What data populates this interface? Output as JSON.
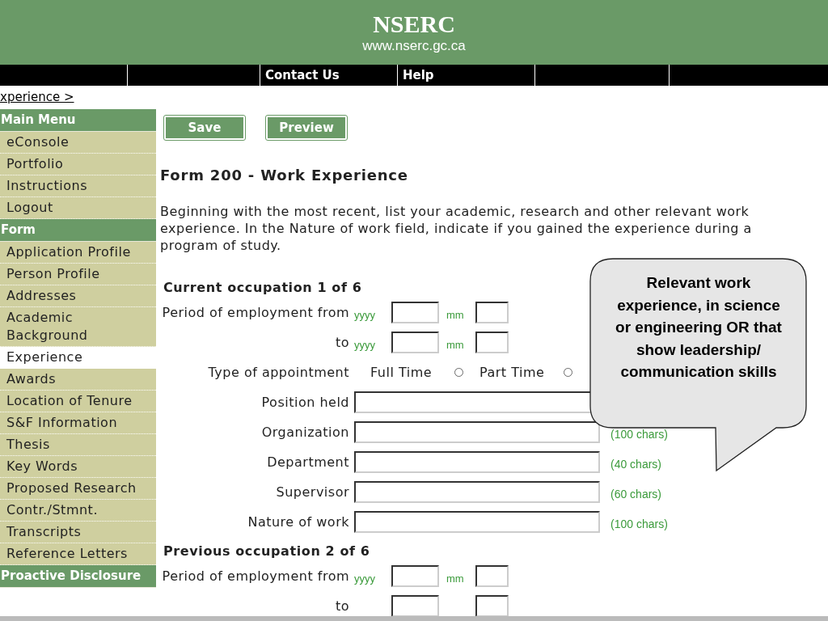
{
  "header": {
    "title": "NSERC",
    "url": "www.nserc.gc.ca"
  },
  "nav": [
    {
      "label": "Contact Us"
    },
    {
      "label": "Help"
    }
  ],
  "breadcrumb": "xperience >",
  "sidebar": [
    {
      "title": "Main Menu",
      "items": [
        {
          "label": "eConsole",
          "selected": false
        },
        {
          "label": "Portfolio",
          "selected": false
        },
        {
          "label": "Instructions",
          "selected": false
        },
        {
          "label": "Logout",
          "selected": false
        }
      ]
    },
    {
      "title": "Form",
      "items": [
        {
          "label": "Application Profile",
          "selected": false
        },
        {
          "label": "Person Profile",
          "selected": false
        },
        {
          "label": "Addresses",
          "selected": false
        },
        {
          "label": "Academic Background",
          "selected": false
        },
        {
          "label": "Experience",
          "selected": true
        },
        {
          "label": "Awards",
          "selected": false
        },
        {
          "label": "Location of Tenure",
          "selected": false
        },
        {
          "label": "S&F Information",
          "selected": false
        },
        {
          "label": "Thesis",
          "selected": false
        },
        {
          "label": "Key Words",
          "selected": false
        },
        {
          "label": "Proposed Research",
          "selected": false
        },
        {
          "label": "Contr./Stmnt.",
          "selected": false
        },
        {
          "label": "Transcripts",
          "selected": false
        },
        {
          "label": "Reference Letters",
          "selected": false
        }
      ]
    },
    {
      "title": "Proactive Disclosure"
    }
  ],
  "buttons": [
    "Save",
    "Preview"
  ],
  "form": {
    "title": "Form 200 - Work Experience",
    "intro": "Beginning with the most recent, list your academic, research and other relevant work experience. In the Nature of work field, indicate if you gained the experience during a program of study.",
    "occupations": [
      {
        "heading": "Current occupation 1 of 6",
        "period_rows": [
          {
            "label": "Period of employment from",
            "year_hint": "yyyy",
            "month_hint": "mm"
          },
          {
            "label": "to",
            "year_hint": "yyyy",
            "month_hint": "mm"
          }
        ],
        "appointment": {
          "label": "Type of appointment",
          "options": [
            {
              "label": "Full Time",
              "selected": false
            },
            {
              "label": "Part Time",
              "selected": false
            }
          ]
        },
        "fields": [
          {
            "label": "Position held"
          },
          {
            "label": "Organization",
            "hint": "(100 chars)"
          },
          {
            "label": "Department",
            "hint": "(40 chars)"
          },
          {
            "label": "Supervisor",
            "hint": "(60 chars)"
          },
          {
            "label": "Nature of work",
            "hint": "(100 chars)"
          }
        ]
      },
      {
        "heading": "Previous occupation 2 of 6",
        "period_rows": [
          {
            "label": "Period of employment from",
            "year_hint": "yyyy",
            "month_hint": "mm"
          },
          {
            "label": "to"
          }
        ]
      }
    ]
  },
  "callout": {
    "text": "Relevant work experience, in science or engineering OR that show leadership/ communication skills"
  }
}
